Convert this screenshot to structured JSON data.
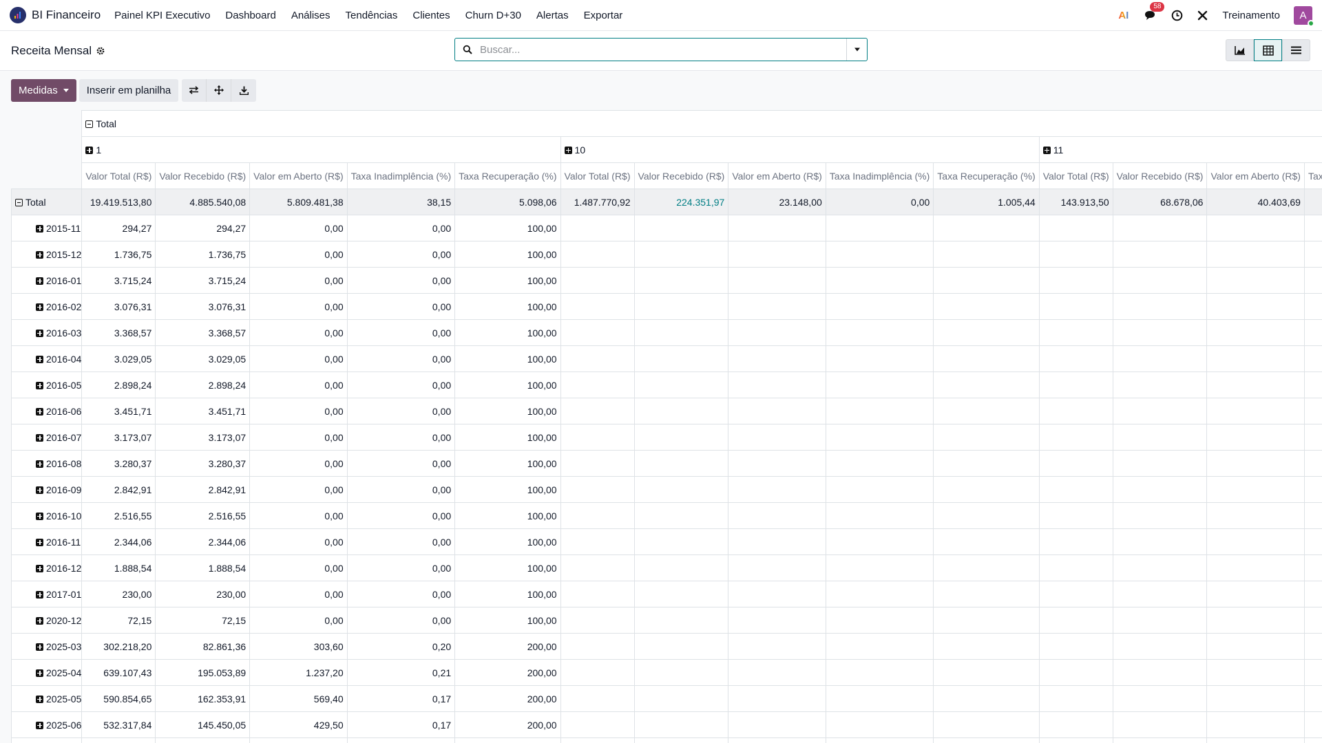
{
  "navbar": {
    "app_name": "BI Financeiro",
    "menu": [
      "Painel KPI Executivo",
      "Dashboard",
      "Análises",
      "Tendências",
      "Clientes",
      "Churn D+30",
      "Alertas",
      "Exportar"
    ],
    "ai_label": "AI",
    "messages_count": "58",
    "user_name": "Treinamento",
    "avatar_letter": "A"
  },
  "control_panel": {
    "title": "Receita Mensal",
    "search_placeholder": "Buscar..."
  },
  "toolbar": {
    "measures_label": "Medidas",
    "insert_label": "Inserir em planilha"
  },
  "pivot": {
    "top_header": "Total",
    "groups": [
      "1",
      "10",
      "11"
    ],
    "measures": [
      "Valor Total (R$)",
      "Valor Recebido (R$)",
      "Valor em Aberto (R$)",
      "Taxa Inadimplência (%)",
      "Taxa Recuperação (%)"
    ],
    "partial_measure": "Taxa",
    "total_row": {
      "label": "Total",
      "g1": [
        "19.419.513,80",
        "4.885.540,08",
        "5.809.481,38",
        "38,15",
        "5.098,06"
      ],
      "g10": [
        "1.487.770,92",
        "224.351,97",
        "23.148,00",
        "0,00",
        "1.005,44"
      ],
      "g11": [
        "143.913,50",
        "68.678,06",
        "40.403,69"
      ]
    },
    "rows": [
      {
        "label": "2015-11",
        "values": [
          "294,27",
          "294,27",
          "0,00",
          "0,00",
          "100,00"
        ]
      },
      {
        "label": "2015-12",
        "values": [
          "1.736,75",
          "1.736,75",
          "0,00",
          "0,00",
          "100,00"
        ]
      },
      {
        "label": "2016-01",
        "values": [
          "3.715,24",
          "3.715,24",
          "0,00",
          "0,00",
          "100,00"
        ]
      },
      {
        "label": "2016-02",
        "values": [
          "3.076,31",
          "3.076,31",
          "0,00",
          "0,00",
          "100,00"
        ]
      },
      {
        "label": "2016-03",
        "values": [
          "3.368,57",
          "3.368,57",
          "0,00",
          "0,00",
          "100,00"
        ]
      },
      {
        "label": "2016-04",
        "values": [
          "3.029,05",
          "3.029,05",
          "0,00",
          "0,00",
          "100,00"
        ]
      },
      {
        "label": "2016-05",
        "values": [
          "2.898,24",
          "2.898,24",
          "0,00",
          "0,00",
          "100,00"
        ]
      },
      {
        "label": "2016-06",
        "values": [
          "3.451,71",
          "3.451,71",
          "0,00",
          "0,00",
          "100,00"
        ]
      },
      {
        "label": "2016-07",
        "values": [
          "3.173,07",
          "3.173,07",
          "0,00",
          "0,00",
          "100,00"
        ]
      },
      {
        "label": "2016-08",
        "values": [
          "3.280,37",
          "3.280,37",
          "0,00",
          "0,00",
          "100,00"
        ]
      },
      {
        "label": "2016-09",
        "values": [
          "2.842,91",
          "2.842,91",
          "0,00",
          "0,00",
          "100,00"
        ]
      },
      {
        "label": "2016-10",
        "values": [
          "2.516,55",
          "2.516,55",
          "0,00",
          "0,00",
          "100,00"
        ]
      },
      {
        "label": "2016-11",
        "values": [
          "2.344,06",
          "2.344,06",
          "0,00",
          "0,00",
          "100,00"
        ]
      },
      {
        "label": "2016-12",
        "values": [
          "1.888,54",
          "1.888,54",
          "0,00",
          "0,00",
          "100,00"
        ]
      },
      {
        "label": "2017-01",
        "values": [
          "230,00",
          "230,00",
          "0,00",
          "0,00",
          "100,00"
        ]
      },
      {
        "label": "2020-12",
        "values": [
          "72,15",
          "72,15",
          "0,00",
          "0,00",
          "100,00"
        ]
      },
      {
        "label": "2025-03",
        "values": [
          "302.218,20",
          "82.861,36",
          "303,60",
          "0,20",
          "200,00"
        ]
      },
      {
        "label": "2025-04",
        "values": [
          "639.107,43",
          "195.053,89",
          "1.237,20",
          "0,21",
          "200,00"
        ]
      },
      {
        "label": "2025-05",
        "values": [
          "590.854,65",
          "162.353,91",
          "569,40",
          "0,17",
          "200,00"
        ]
      },
      {
        "label": "2025-06",
        "values": [
          "532.317,84",
          "145.450,05",
          "429,50",
          "0,17",
          "200,00"
        ]
      },
      {
        "label": "",
        "values": [
          "",
          "",
          "",
          "",
          ""
        ]
      }
    ]
  }
}
